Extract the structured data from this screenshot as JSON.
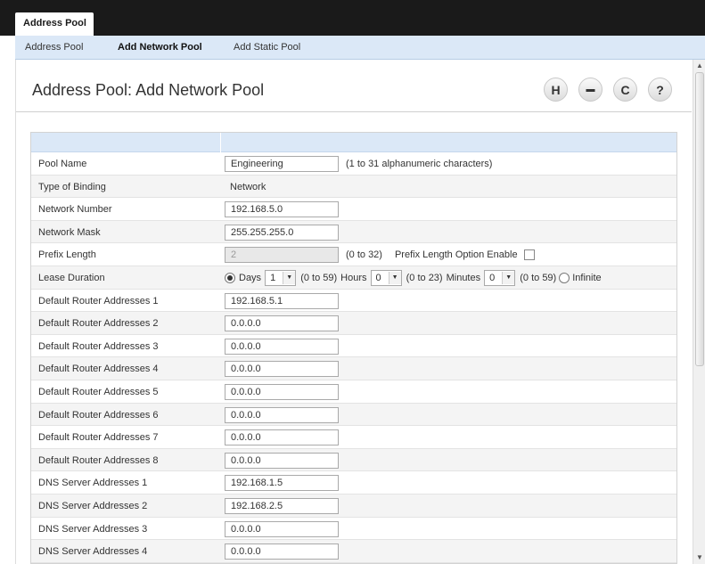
{
  "top_tab": {
    "label": "Address Pool"
  },
  "subnav": {
    "items": [
      {
        "label": "Address Pool"
      },
      {
        "label": "Add Network Pool"
      },
      {
        "label": "Add Static Pool"
      }
    ]
  },
  "page": {
    "title": "Address Pool: Add Network Pool"
  },
  "toolbar": {
    "buttons": [
      {
        "icon": "save-icon",
        "glyph": "H"
      },
      {
        "icon": "print-icon",
        "glyph": "▬"
      },
      {
        "icon": "refresh-icon",
        "glyph": "C"
      },
      {
        "icon": "help-icon",
        "glyph": "?"
      }
    ]
  },
  "form": {
    "pool_name": {
      "label": "Pool Name",
      "value": "Engineering",
      "hint": "(1 to 31 alphanumeric characters)"
    },
    "binding": {
      "label": "Type of Binding",
      "value": "Network"
    },
    "network_number": {
      "label": "Network Number",
      "value": "192.168.5.0"
    },
    "network_mask": {
      "label": "Network Mask",
      "value": "255.255.255.0"
    },
    "prefix_length": {
      "label": "Prefix Length",
      "value": "2",
      "hint": "(0 to 32)",
      "option_label": "Prefix Length Option Enable"
    },
    "lease": {
      "label": "Lease Duration",
      "days_label": "Days",
      "days_value": "1",
      "days_range": "(0 to 59)",
      "hours_label": "Hours",
      "hours_value": "0",
      "hours_range": "(0 to 23)",
      "minutes_label": "Minutes",
      "minutes_value": "0",
      "minutes_range": "(0 to 59)",
      "infinite_label": "Infinite"
    },
    "routers": [
      {
        "label": "Default Router Addresses 1",
        "value": "192.168.5.1"
      },
      {
        "label": "Default Router Addresses 2",
        "value": "0.0.0.0"
      },
      {
        "label": "Default Router Addresses 3",
        "value": "0.0.0.0"
      },
      {
        "label": "Default Router Addresses 4",
        "value": "0.0.0.0"
      },
      {
        "label": "Default Router Addresses 5",
        "value": "0.0.0.0"
      },
      {
        "label": "Default Router Addresses 6",
        "value": "0.0.0.0"
      },
      {
        "label": "Default Router Addresses 7",
        "value": "0.0.0.0"
      },
      {
        "label": "Default Router Addresses 8",
        "value": "0.0.0.0"
      }
    ],
    "dns": [
      {
        "label": "DNS Server Addresses 1",
        "value": "192.168.1.5"
      },
      {
        "label": "DNS Server Addresses 2",
        "value": "192.168.2.5"
      },
      {
        "label": "DNS Server Addresses 3",
        "value": "0.0.0.0"
      },
      {
        "label": "DNS Server Addresses 4",
        "value": "0.0.0.0"
      }
    ]
  }
}
